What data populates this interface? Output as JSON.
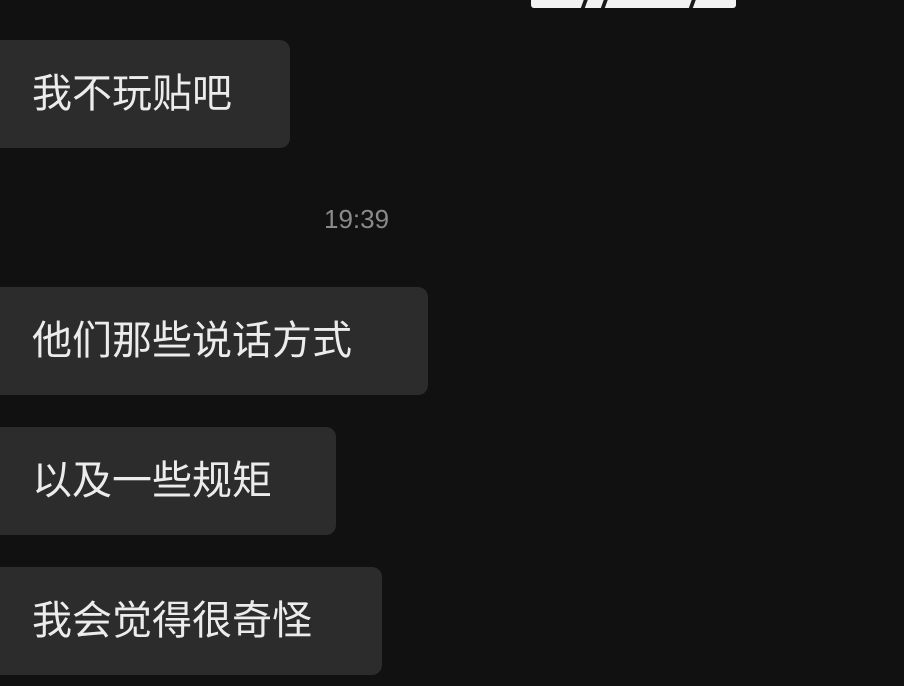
{
  "messages": [
    {
      "text": "我不玩贴吧"
    },
    {
      "text": "他们那些说话方式"
    },
    {
      "text": "以及一些规矩"
    },
    {
      "text": "我会觉得很奇怪"
    }
  ],
  "timestamp": "19:39"
}
